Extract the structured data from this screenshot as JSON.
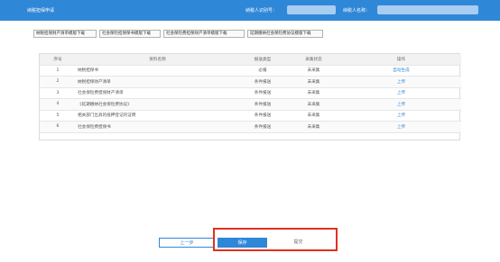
{
  "header": {
    "title": "纳税担保申请",
    "taxpayer_id_label": "纳税人识别号：",
    "taxpayer_name_label": "纳税人名称："
  },
  "download_buttons": [
    "纳税担保财产清单模版下载",
    "社会保险担保保书模版下载",
    "社会保险费担保财产清单模版下载",
    "延期缴纳社会保险费协议模版下载"
  ],
  "table": {
    "columns": [
      "序号",
      "资料名称",
      "报送类型",
      "采集状态",
      "操作"
    ],
    "rows": [
      {
        "no": "1",
        "name": "纳税担保书",
        "type": "必报",
        "status": "未采集",
        "op": "自动生成"
      },
      {
        "no": "2",
        "name": "纳税担保财产清单",
        "type": "条件报送",
        "status": "未采集",
        "op": "上传"
      },
      {
        "no": "3",
        "name": "社会保险费担保财产清单",
        "type": "条件报送",
        "status": "未采集",
        "op": "上传"
      },
      {
        "no": "4",
        "name": "《延期缴纳社会保险费协议》",
        "type": "条件报送",
        "status": "未采集",
        "op": "上传"
      },
      {
        "no": "5",
        "name": "相关部门出具的抵押登记的证明",
        "type": "条件报送",
        "status": "未采集",
        "op": "上传"
      },
      {
        "no": "6",
        "name": "社会保险费担保书",
        "type": "条件报送",
        "status": "未采集",
        "op": "上传"
      }
    ]
  },
  "footer": {
    "prev_label": "上一步",
    "save_label": "保存",
    "submit_label": "提交"
  },
  "colors": {
    "header_bg": "#2f87d8",
    "link": "#2f87d8",
    "highlight": "#e1301f"
  }
}
